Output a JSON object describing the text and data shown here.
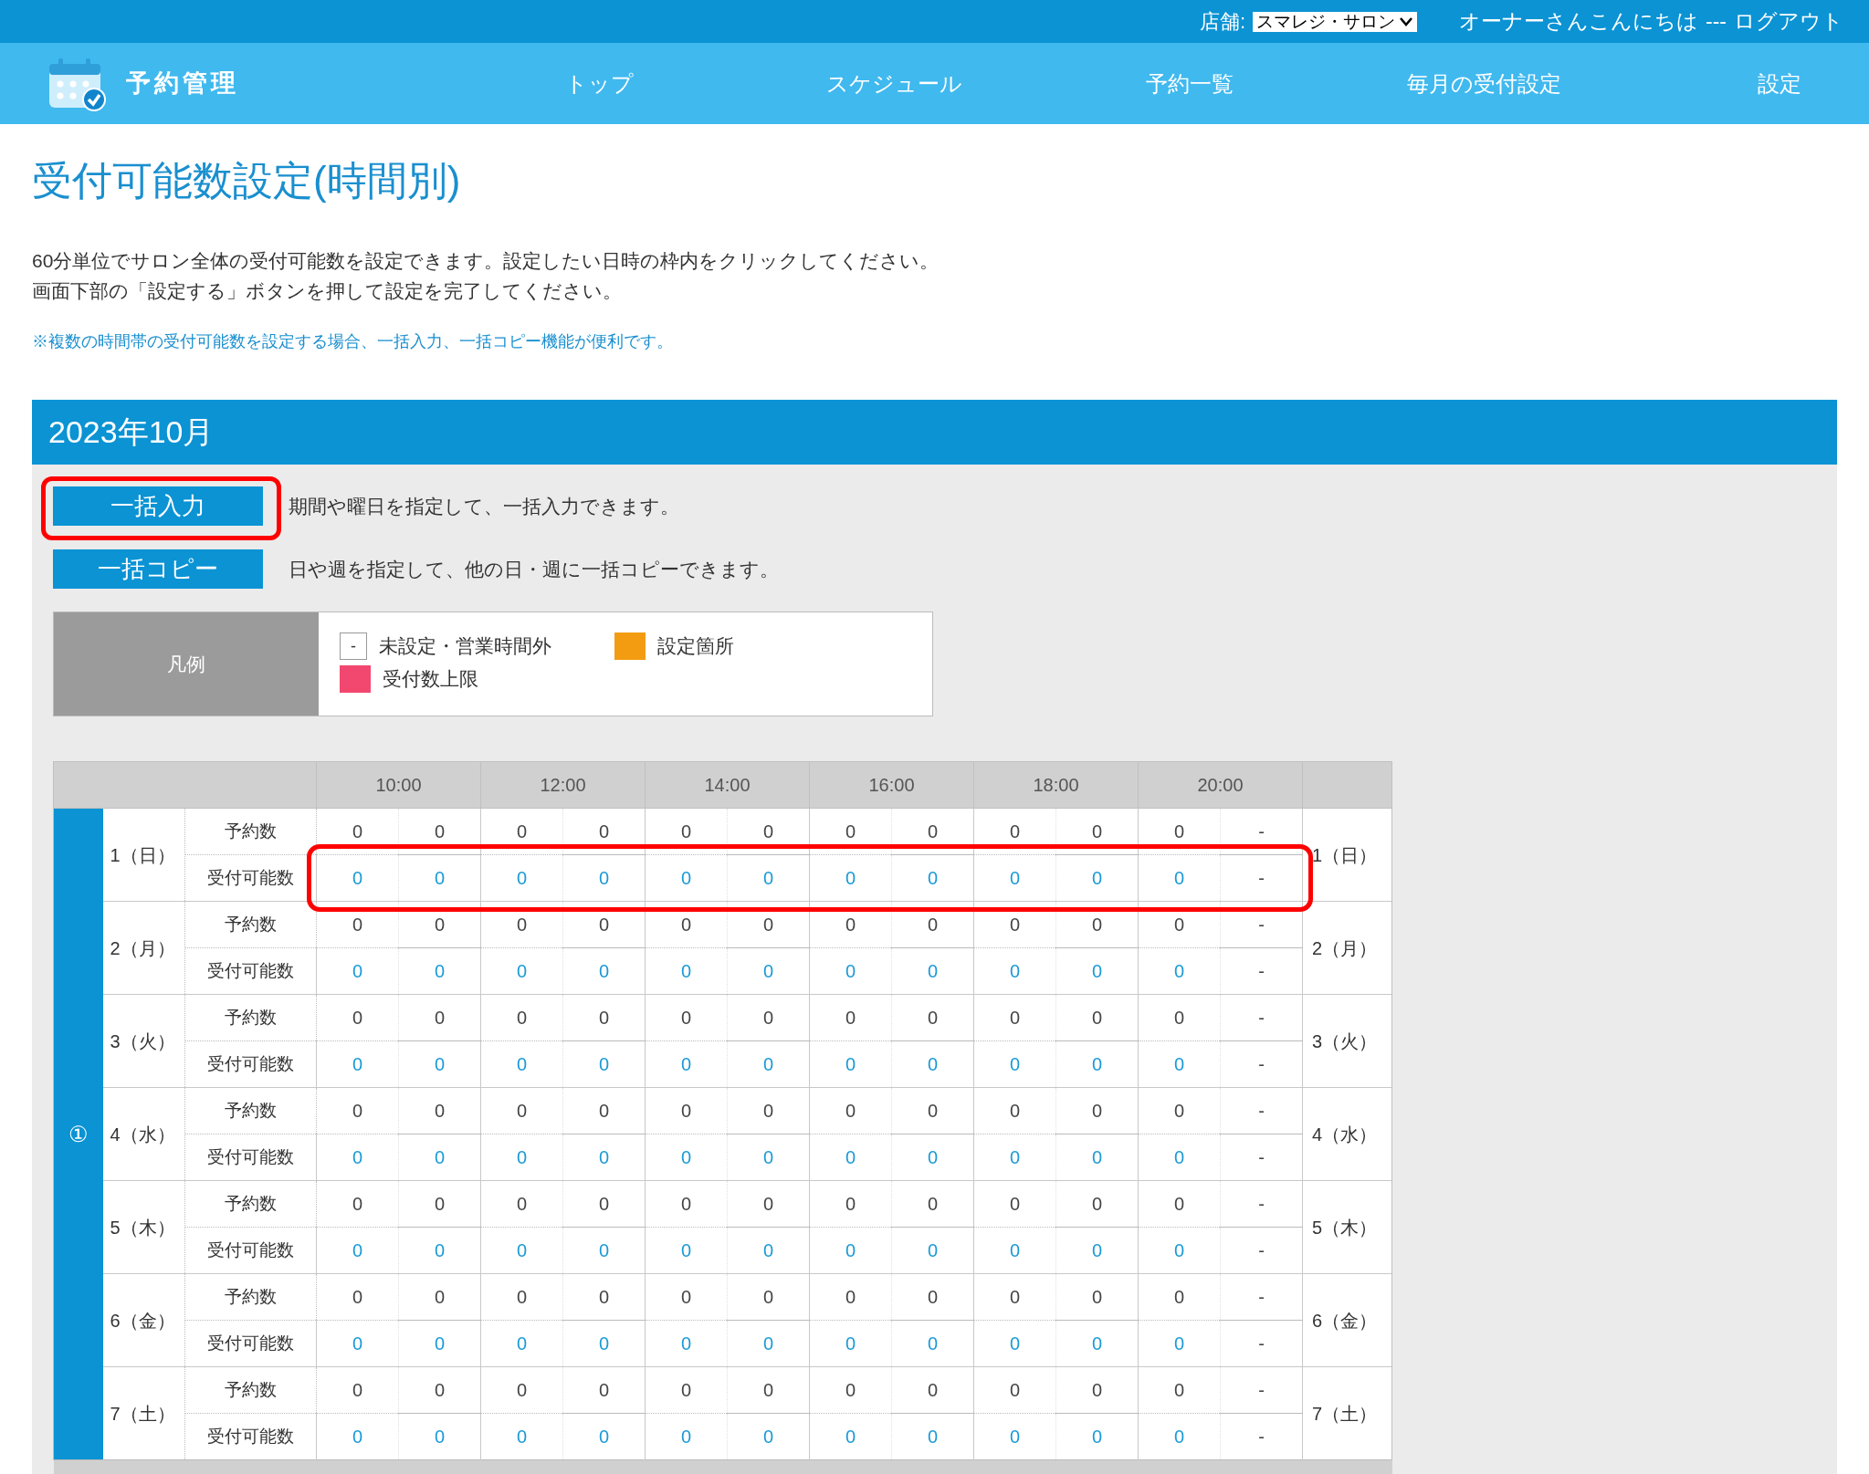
{
  "topbar": {
    "store_label": "店舗:",
    "store_value": "スマレジ・サロン",
    "greeting": "オーナーさんこんにちは",
    "separator": "---",
    "logout": "ログアウト"
  },
  "nav": {
    "logo": "予約管理",
    "items": [
      {
        "label": "トップ"
      },
      {
        "label": "スケジュール"
      },
      {
        "label": "予約一覧"
      },
      {
        "label": "毎月の受付設定"
      },
      {
        "label": "設定"
      }
    ]
  },
  "page_title": "受付可能数設定(時間別)",
  "description": [
    "60分単位でサロン全体の受付可能数を設定できます。設定したい日時の枠内をクリックしてください。",
    "画面下部の「設定する」ボタンを押して設定を完了してください。"
  ],
  "note": "※複数の時間帯の受付可能数を設定する場合、一括入力、一括コピー機能が便利です。",
  "month": "2023年10月",
  "actions": [
    {
      "label": "一括入力",
      "description": "期間や曜日を指定して、一括入力できます。",
      "highlighted": true
    },
    {
      "label": "一括コピー",
      "description": "日や週を指定して、他の日・週に一括コピーできます。",
      "highlighted": false
    }
  ],
  "legend": {
    "title": "凡例",
    "items": [
      {
        "kind": "dash",
        "symbol": "-",
        "label": "未設定・営業時間外"
      },
      {
        "kind": "swatch",
        "color": "#f39c12",
        "label": "設定箇所"
      },
      {
        "kind": "swatch",
        "color": "#f2486f",
        "label": "受付数上限"
      }
    ]
  },
  "table": {
    "times": [
      "10:00",
      "12:00",
      "14:00",
      "16:00",
      "18:00",
      "20:00"
    ],
    "week_label": "①",
    "days": [
      {
        "label": "1（日）",
        "label_right": "1（日）",
        "booking_label": "予約数",
        "capacity_label": "受付可能数",
        "highlighted": true,
        "bookings": [
          "0",
          "0",
          "0",
          "0",
          "0",
          "0",
          "0",
          "0",
          "0",
          "0",
          "0",
          "-"
        ],
        "capacity": [
          {
            "value": "0",
            "open": true
          },
          {
            "value": "0",
            "open": true
          },
          {
            "value": "0",
            "open": true
          },
          {
            "value": "0",
            "open": true
          },
          {
            "value": "0",
            "open": true
          },
          {
            "value": "0",
            "open": true
          },
          {
            "value": "0",
            "open": true
          },
          {
            "value": "0",
            "open": true
          },
          {
            "value": "0",
            "open": true
          },
          {
            "value": "0",
            "open": true
          },
          {
            "value": "0",
            "open": true
          },
          {
            "value": "-",
            "open": false
          }
        ]
      },
      {
        "label": "2（月）",
        "label_right": "2（月）",
        "booking_label": "予約数",
        "capacity_label": "受付可能数",
        "highlighted": false,
        "bookings": [
          "0",
          "0",
          "0",
          "0",
          "0",
          "0",
          "0",
          "0",
          "0",
          "0",
          "0",
          "-"
        ],
        "capacity": [
          {
            "value": "0",
            "open": true
          },
          {
            "value": "0",
            "open": true
          },
          {
            "value": "0",
            "open": true
          },
          {
            "value": "0",
            "open": true
          },
          {
            "value": "0",
            "open": true
          },
          {
            "value": "0",
            "open": true
          },
          {
            "value": "0",
            "open": true
          },
          {
            "value": "0",
            "open": true
          },
          {
            "value": "0",
            "open": true
          },
          {
            "value": "0",
            "open": true
          },
          {
            "value": "0",
            "open": true
          },
          {
            "value": "-",
            "open": false
          }
        ]
      },
      {
        "label": "3（火）",
        "label_right": "3（火）",
        "booking_label": "予約数",
        "capacity_label": "受付可能数",
        "highlighted": false,
        "bookings": [
          "0",
          "0",
          "0",
          "0",
          "0",
          "0",
          "0",
          "0",
          "0",
          "0",
          "0",
          "-"
        ],
        "capacity": [
          {
            "value": "0",
            "open": true
          },
          {
            "value": "0",
            "open": true
          },
          {
            "value": "0",
            "open": true
          },
          {
            "value": "0",
            "open": true
          },
          {
            "value": "0",
            "open": true
          },
          {
            "value": "0",
            "open": true
          },
          {
            "value": "0",
            "open": true
          },
          {
            "value": "0",
            "open": true
          },
          {
            "value": "0",
            "open": true
          },
          {
            "value": "0",
            "open": true
          },
          {
            "value": "0",
            "open": true
          },
          {
            "value": "-",
            "open": false
          }
        ]
      },
      {
        "label": "4（水）",
        "label_right": "4（水）",
        "booking_label": "予約数",
        "capacity_label": "受付可能数",
        "highlighted": false,
        "bookings": [
          "0",
          "0",
          "0",
          "0",
          "0",
          "0",
          "0",
          "0",
          "0",
          "0",
          "0",
          "-"
        ],
        "capacity": [
          {
            "value": "0",
            "open": true
          },
          {
            "value": "0",
            "open": true
          },
          {
            "value": "0",
            "open": true
          },
          {
            "value": "0",
            "open": true
          },
          {
            "value": "0",
            "open": true
          },
          {
            "value": "0",
            "open": true
          },
          {
            "value": "0",
            "open": true
          },
          {
            "value": "0",
            "open": true
          },
          {
            "value": "0",
            "open": true
          },
          {
            "value": "0",
            "open": true
          },
          {
            "value": "0",
            "open": true
          },
          {
            "value": "-",
            "open": false
          }
        ]
      },
      {
        "label": "5（木）",
        "label_right": "5（木）",
        "booking_label": "予約数",
        "capacity_label": "受付可能数",
        "highlighted": false,
        "bookings": [
          "0",
          "0",
          "0",
          "0",
          "0",
          "0",
          "0",
          "0",
          "0",
          "0",
          "0",
          "-"
        ],
        "capacity": [
          {
            "value": "0",
            "open": true
          },
          {
            "value": "0",
            "open": true
          },
          {
            "value": "0",
            "open": true
          },
          {
            "value": "0",
            "open": true
          },
          {
            "value": "0",
            "open": true
          },
          {
            "value": "0",
            "open": true
          },
          {
            "value": "0",
            "open": true
          },
          {
            "value": "0",
            "open": true
          },
          {
            "value": "0",
            "open": true
          },
          {
            "value": "0",
            "open": true
          },
          {
            "value": "0",
            "open": true
          },
          {
            "value": "-",
            "open": false
          }
        ]
      },
      {
        "label": "6（金）",
        "label_right": "6（金）",
        "booking_label": "予約数",
        "capacity_label": "受付可能数",
        "highlighted": false,
        "bookings": [
          "0",
          "0",
          "0",
          "0",
          "0",
          "0",
          "0",
          "0",
          "0",
          "0",
          "0",
          "-"
        ],
        "capacity": [
          {
            "value": "0",
            "open": true
          },
          {
            "value": "0",
            "open": true
          },
          {
            "value": "0",
            "open": true
          },
          {
            "value": "0",
            "open": true
          },
          {
            "value": "0",
            "open": true
          },
          {
            "value": "0",
            "open": true
          },
          {
            "value": "0",
            "open": true
          },
          {
            "value": "0",
            "open": true
          },
          {
            "value": "0",
            "open": true
          },
          {
            "value": "0",
            "open": true
          },
          {
            "value": "0",
            "open": true
          },
          {
            "value": "-",
            "open": false
          }
        ]
      },
      {
        "label": "7（土）",
        "label_right": "7（土）",
        "booking_label": "予約数",
        "capacity_label": "受付可能数",
        "highlighted": false,
        "bookings": [
          "0",
          "0",
          "0",
          "0",
          "0",
          "0",
          "0",
          "0",
          "0",
          "0",
          "0",
          "-"
        ],
        "capacity": [
          {
            "value": "0",
            "open": true
          },
          {
            "value": "0",
            "open": true
          },
          {
            "value": "0",
            "open": true
          },
          {
            "value": "0",
            "open": true
          },
          {
            "value": "0",
            "open": true
          },
          {
            "value": "0",
            "open": true
          },
          {
            "value": "0",
            "open": true
          },
          {
            "value": "0",
            "open": true
          },
          {
            "value": "0",
            "open": true
          },
          {
            "value": "0",
            "open": true
          },
          {
            "value": "0",
            "open": true
          },
          {
            "value": "-",
            "open": false
          }
        ]
      }
    ]
  }
}
